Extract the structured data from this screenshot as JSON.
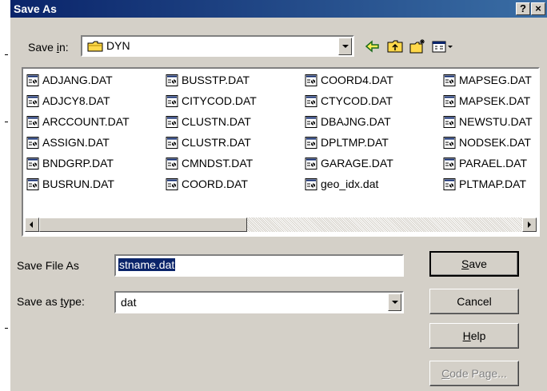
{
  "window": {
    "title": "Save As",
    "help_glyph": "?",
    "close_glyph": "×"
  },
  "save_in": {
    "label_pre": "Save ",
    "label_key": "i",
    "label_post": "n:",
    "value": "DYN"
  },
  "toolbar": {
    "icons": [
      "back-arrow-icon",
      "up-folder-icon",
      "new-folder-icon",
      "view-menu-icon"
    ]
  },
  "files": {
    "col1": [
      "ADJANG.DAT",
      "ADJCY8.DAT",
      "ARCCOUNT.DAT",
      "ASSIGN.DAT",
      "BNDGRP.DAT",
      "BUSRUN.DAT"
    ],
    "col2": [
      "BUSSTP.DAT",
      "CITYCOD.DAT",
      "CLUSTN.DAT",
      "CLUSTR.DAT",
      "CMNDST.DAT",
      "COORD.DAT"
    ],
    "col3": [
      "COORD4.DAT",
      "CTYCOD.DAT",
      "DBAJNG.DAT",
      "DPLTMP.DAT",
      "GARAGE.DAT",
      "geo_idx.dat"
    ],
    "col4": [
      "MAPSEG.DAT",
      "MAPSEK.DAT",
      "NEWSTU.DAT",
      "NODSEK.DAT",
      "PARAEL.DAT",
      "PLTMAP.DAT"
    ]
  },
  "filename": {
    "label": "Save File As",
    "value": "stname.dat"
  },
  "filetype": {
    "label_pre": "Save as ",
    "label_key": "t",
    "label_post": "ype:",
    "value": "dat"
  },
  "buttons": {
    "save_key": "S",
    "save_rest": "ave",
    "cancel": "Cancel",
    "help_key": "H",
    "help_rest": "elp",
    "codepage_key": "C",
    "codepage_rest": "ode Page..."
  },
  "colors": {
    "titlebar": "#0a246a",
    "face": "#d4d0c8",
    "selection": "#0a246a"
  }
}
